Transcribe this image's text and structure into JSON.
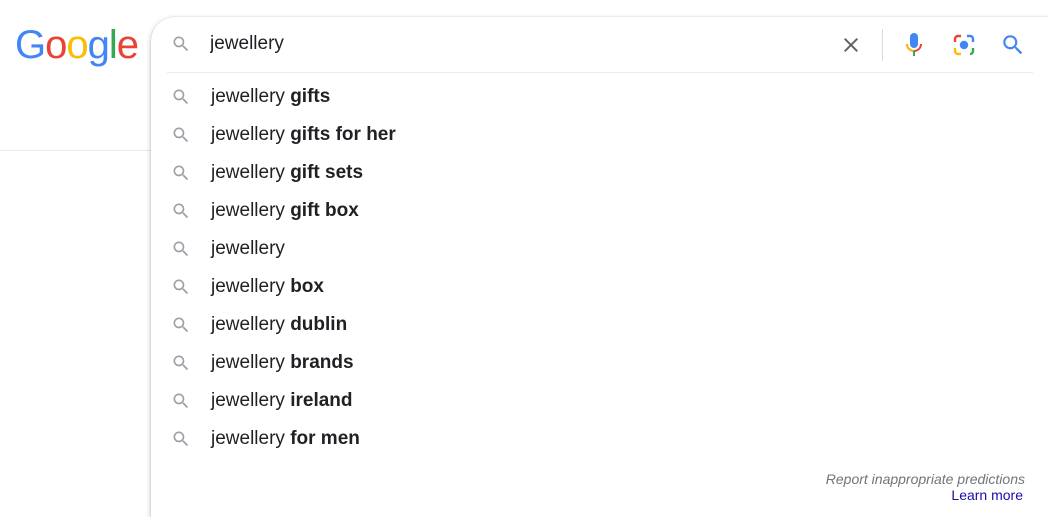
{
  "logo": {
    "letters": [
      "G",
      "o",
      "o",
      "g",
      "l",
      "e"
    ],
    "colors": [
      "#4285F4",
      "#EA4335",
      "#FBBC05",
      "#4285F4",
      "#34A853",
      "#EA4335"
    ]
  },
  "search": {
    "query": "jewellery",
    "icons": {
      "left": "search-icon",
      "clear": "close-icon",
      "voice": "microphone-icon",
      "lens": "camera-lens-icon",
      "submit": "search-icon"
    },
    "colors": {
      "accent": "#4285F4",
      "icon_gray": "#9aa0a6",
      "clear_gray": "#5f6368"
    }
  },
  "suggestions": [
    {
      "prefix": "jewellery ",
      "bold": "gifts"
    },
    {
      "prefix": "jewellery ",
      "bold": "gifts for her"
    },
    {
      "prefix": "jewellery ",
      "bold": "gift sets"
    },
    {
      "prefix": "jewellery ",
      "bold": "gift box"
    },
    {
      "prefix": "jewellery",
      "bold": ""
    },
    {
      "prefix": "jewellery ",
      "bold": "box"
    },
    {
      "prefix": "jewellery ",
      "bold": "dublin"
    },
    {
      "prefix": "jewellery ",
      "bold": "brands"
    },
    {
      "prefix": "jewellery ",
      "bold": "ireland"
    },
    {
      "prefix": "jewellery ",
      "bold": "for men"
    }
  ],
  "footer": {
    "report": "Report inappropriate predictions",
    "learn_more": "Learn more"
  }
}
